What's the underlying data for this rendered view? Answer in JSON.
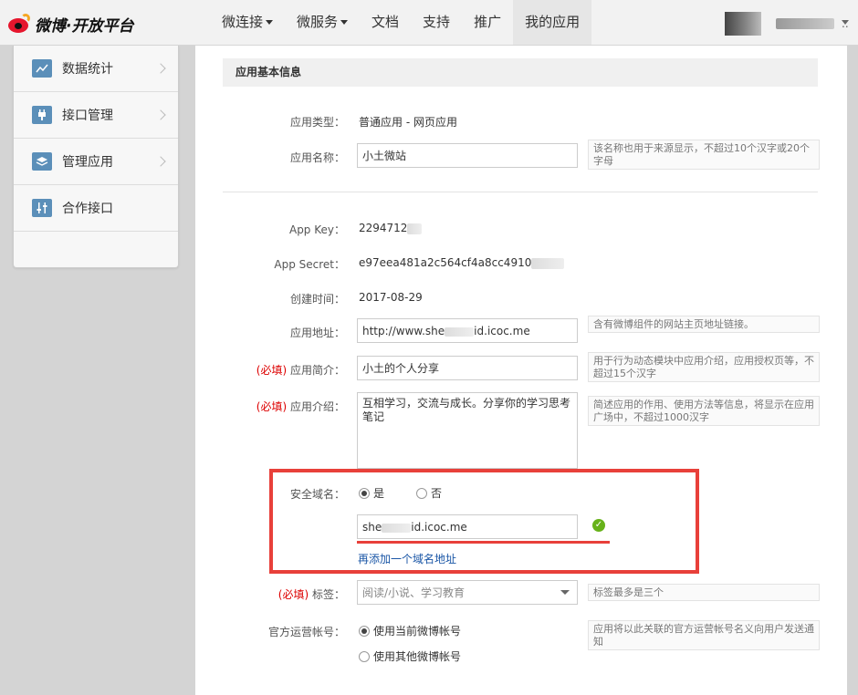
{
  "brand": {
    "logo_text": "微博·开放平台"
  },
  "nav": {
    "items": [
      {
        "label": "微连接",
        "dropdown": true
      },
      {
        "label": "微服务",
        "dropdown": true
      },
      {
        "label": "文档",
        "dropdown": false
      },
      {
        "label": "支持",
        "dropdown": false
      },
      {
        "label": "推广",
        "dropdown": false
      },
      {
        "label": "我的应用",
        "dropdown": false,
        "active": true
      }
    ],
    "user_more": ".."
  },
  "sidebar": {
    "items": [
      {
        "label": "数据统计",
        "icon": "chart-icon"
      },
      {
        "label": "接口管理",
        "icon": "plug-icon"
      },
      {
        "label": "管理应用",
        "icon": "layers-icon"
      },
      {
        "label": "合作接口",
        "icon": "sliders-icon"
      }
    ]
  },
  "form": {
    "section_title": "应用基本信息",
    "app_type": {
      "label": "应用类型：",
      "value": "普通应用 - 网页应用"
    },
    "app_name": {
      "label": "应用名称：",
      "value": "小土微站",
      "hint": "该名称也用于来源显示，不超过10个汉字或20个字母"
    },
    "app_key": {
      "label": "App Key：",
      "value": "2294712"
    },
    "app_secret": {
      "label": "App Secret：",
      "value": "e97eea481a2c564cf4a8cc4910"
    },
    "created": {
      "label": "创建时间：",
      "value": "2017-08-29"
    },
    "app_url": {
      "label": "应用地址：",
      "value_start": "http://www.she",
      "value_end": "id.icoc.me",
      "hint": "含有微博组件的网站主页地址链接。"
    },
    "required_mark": "(必填)",
    "app_summary": {
      "label": "应用简介：",
      "value": "小土的个人分享",
      "hint": "用于行为动态模块中应用介绍，应用授权页等，不超过15个汉字"
    },
    "app_intro": {
      "label": "应用介绍：",
      "value": "互相学习，交流与成长。分享你的学习思考笔记",
      "hint": "简述应用的作用、使用方法等信息，将显示在应用广场中，不超过1000汉字"
    },
    "secure_domain": {
      "label": "安全域名：",
      "options": [
        "是",
        "否"
      ],
      "selected": "是",
      "value_start": "she",
      "value_end": "id.icoc.me",
      "add_link": "再添加一个域名地址"
    },
    "tags": {
      "label": "标签：",
      "value": "阅读/小说、学习教育",
      "hint": "标签最多是三个"
    },
    "official_account": {
      "label": "官方运营帐号：",
      "options": [
        "使用当前微博帐号",
        "使用其他微博帐号"
      ],
      "selected": "使用当前微博帐号",
      "hint": "应用将以此关联的官方运营帐号名义向用户发送通知"
    }
  },
  "colors": {
    "brand_red": "#e6162d",
    "highlight": "#e8403a",
    "ok_green": "#67b21a",
    "link": "#1a56a6"
  }
}
